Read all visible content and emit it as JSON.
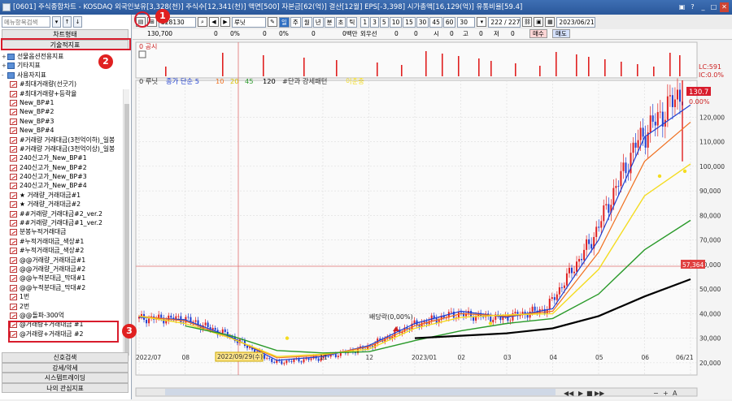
{
  "window": {
    "title": "[0601] 주식종합차트 - KOSDAQ 외국인보유[3,328(천)] 주식수[12,341(천)] 액면[500] 자본금[62(억)] 결산[12월] EPS[-3,398] 시가총액[16,129(억)] 유통비율[59.4]",
    "controls": [
      "▣",
      "?",
      "_",
      "□",
      "✕"
    ]
  },
  "left_panel": {
    "search_placeholder": "메뉴항목검색",
    "top_tabs": [
      "차트형태",
      "기술적지표"
    ],
    "tree_items": [
      {
        "label": "선물옵션전용지표",
        "kind": "folder",
        "expander": "+"
      },
      {
        "label": "기타지표",
        "kind": "folder",
        "expander": "+"
      },
      {
        "label": "사용자지표",
        "kind": "folder",
        "expander": "-"
      },
      {
        "label": "#최대거래량(선굿기)",
        "kind": "chart"
      },
      {
        "label": "#최대거래량+등락율",
        "kind": "chart"
      },
      {
        "label": "New_BP#1",
        "kind": "chart"
      },
      {
        "label": "New_BP#2",
        "kind": "chart"
      },
      {
        "label": "New_BP#3",
        "kind": "chart"
      },
      {
        "label": "New_BP#4",
        "kind": "chart"
      },
      {
        "label": "#거래량 거래대금(3천억이하)_일봉",
        "kind": "chart"
      },
      {
        "label": "#거래량 거래대금(3천억이상)_일봉",
        "kind": "chart"
      },
      {
        "label": "240신고가_New_BP#1",
        "kind": "chart"
      },
      {
        "label": "240신고가_New_BP#2",
        "kind": "chart"
      },
      {
        "label": "240신고가_New_BP#3",
        "kind": "chart"
      },
      {
        "label": "240신고가_New_BP#4",
        "kind": "chart"
      },
      {
        "label": "★ 거래량_거래대금#1",
        "kind": "chart"
      },
      {
        "label": "★ 거래량_거래대금#2",
        "kind": "chart"
      },
      {
        "label": "##거래량_거래대금#2_ver.2",
        "kind": "chart"
      },
      {
        "label": "##거래량_거래대금#1_ver.2",
        "kind": "chart"
      },
      {
        "label": "분봉누적거래대금",
        "kind": "chart"
      },
      {
        "label": "#누적거래대금_색상#1",
        "kind": "chart"
      },
      {
        "label": "#누적거래대금_색상#2",
        "kind": "chart"
      },
      {
        "label": "@@거래량_거래대금#1",
        "kind": "chart"
      },
      {
        "label": "@@거래량_거래대금#2",
        "kind": "chart"
      },
      {
        "label": "@@누적분대금_막대#1",
        "kind": "chart"
      },
      {
        "label": "@@누적분대금_막대#2",
        "kind": "chart"
      },
      {
        "label": "1번",
        "kind": "chart"
      },
      {
        "label": "2번",
        "kind": "chart"
      },
      {
        "label": "@@돌파-300억",
        "kind": "chart"
      },
      {
        "label": "@거래량+거래대금 #1",
        "kind": "chart"
      },
      {
        "label": "@거래량+거래대금 #2",
        "kind": "chart"
      }
    ],
    "bottom_buttons": [
      "신호검색",
      "강세/약세",
      "시스템트레이딩",
      "나의 관심지표"
    ]
  },
  "toolbar": {
    "code": "328130",
    "stock_name": "루닛",
    "period_buttons": [
      "일",
      "주",
      "월",
      "년",
      "분",
      "초",
      "틱"
    ],
    "minute_buttons": [
      "1",
      "3",
      "5",
      "10",
      "15",
      "30",
      "45",
      "60"
    ],
    "interval_value": "30",
    "count_value": "222 / 227",
    "date_value": "2023/06/21"
  },
  "info_row": {
    "price": "130,700",
    "zero1": "0",
    "pct1": "0%",
    "zero2": "0",
    "pct2": "0%",
    "zero3": "0",
    "volume_label": "0백만",
    "seller": "외우선",
    "zero4": "0",
    "zero5": "0",
    "si": "시",
    "zero6": "0",
    "go": "고",
    "zero7": "0",
    "jeo": "저",
    "zero8": "0",
    "buy": "매수",
    "sell": "매도"
  },
  "chart": {
    "top_panel_label": "0 공시",
    "legend": {
      "stock": "0 루닛",
      "ma_title": "종가 단순 5",
      "ma10": "10",
      "ma20": "20",
      "ma45": "45",
      "ma120": "120",
      "pattern": "#단과 강세패턴",
      "neutral": "이준중"
    },
    "dividend_label": "배당락(0,00%)",
    "date_marker": "2022/09/29(수)",
    "price_tags": {
      "top1": "LC:591",
      "top2": "IC:0.0%",
      "last": "130.7",
      "pct": "0.00%",
      "line": "57,364"
    },
    "y_ticks": [
      "120,000",
      "110,000",
      "100,000",
      "90,000",
      "80,000",
      "70,000",
      "60,000",
      "50,000",
      "40,000",
      "30,000",
      "20,000"
    ],
    "x_ticks": [
      "2022/07",
      "08",
      "09",
      "2022/09/29(수)",
      "11",
      "12",
      "2023/01",
      "02",
      "03",
      "04",
      "05",
      "06",
      "06/21"
    ]
  },
  "annotations": [
    "1",
    "2",
    "3"
  ],
  "colors": {
    "up": "#e02020",
    "down": "#1f3fd0",
    "ma5": "#1f3fd0",
    "ma10": "#f07020",
    "ma20": "#f4dc20",
    "ma45": "#2a9a2a",
    "ma120": "#000000",
    "marker": "#d81c2c"
  },
  "chart_data": {
    "type": "line",
    "x": [
      "2022/07",
      "08",
      "09",
      "10",
      "11",
      "12",
      "2023/01",
      "02",
      "03",
      "04",
      "05",
      "06",
      "06/21"
    ],
    "series": [
      {
        "name": "루닛",
        "values": [
          38000,
          38000,
          31000,
          20000,
          22000,
          26000,
          35000,
          40000,
          38000,
          42000,
          70000,
          110000,
          130700
        ]
      },
      {
        "name": "5",
        "values": [
          38500,
          37500,
          30500,
          21000,
          22500,
          27000,
          36000,
          41000,
          38500,
          42000,
          70000,
          112000,
          125000
        ]
      },
      {
        "name": "10",
        "values": [
          39000,
          37000,
          30000,
          22000,
          23000,
          26500,
          35000,
          40000,
          39000,
          41000,
          65000,
          102000,
          118000
        ]
      },
      {
        "name": "20",
        "values": [
          39000,
          36000,
          30000,
          22500,
          23500,
          25500,
          34000,
          38500,
          39500,
          40000,
          58000,
          88000,
          101000
        ]
      },
      {
        "name": "45",
        "values": [
          null,
          35000,
          31000,
          25000,
          24000,
          24500,
          29000,
          33000,
          36000,
          38000,
          48000,
          66000,
          78000
        ]
      },
      {
        "name": "120",
        "values": [
          null,
          null,
          null,
          null,
          null,
          null,
          30000,
          31000,
          32000,
          34000,
          39000,
          47000,
          54000
        ]
      }
    ],
    "ylim": [
      15000,
      135000
    ],
    "ytick_values": [
      20000,
      30000,
      40000,
      50000,
      60000,
      70000,
      80000,
      90000,
      100000,
      110000,
      120000
    ],
    "grid": true
  }
}
